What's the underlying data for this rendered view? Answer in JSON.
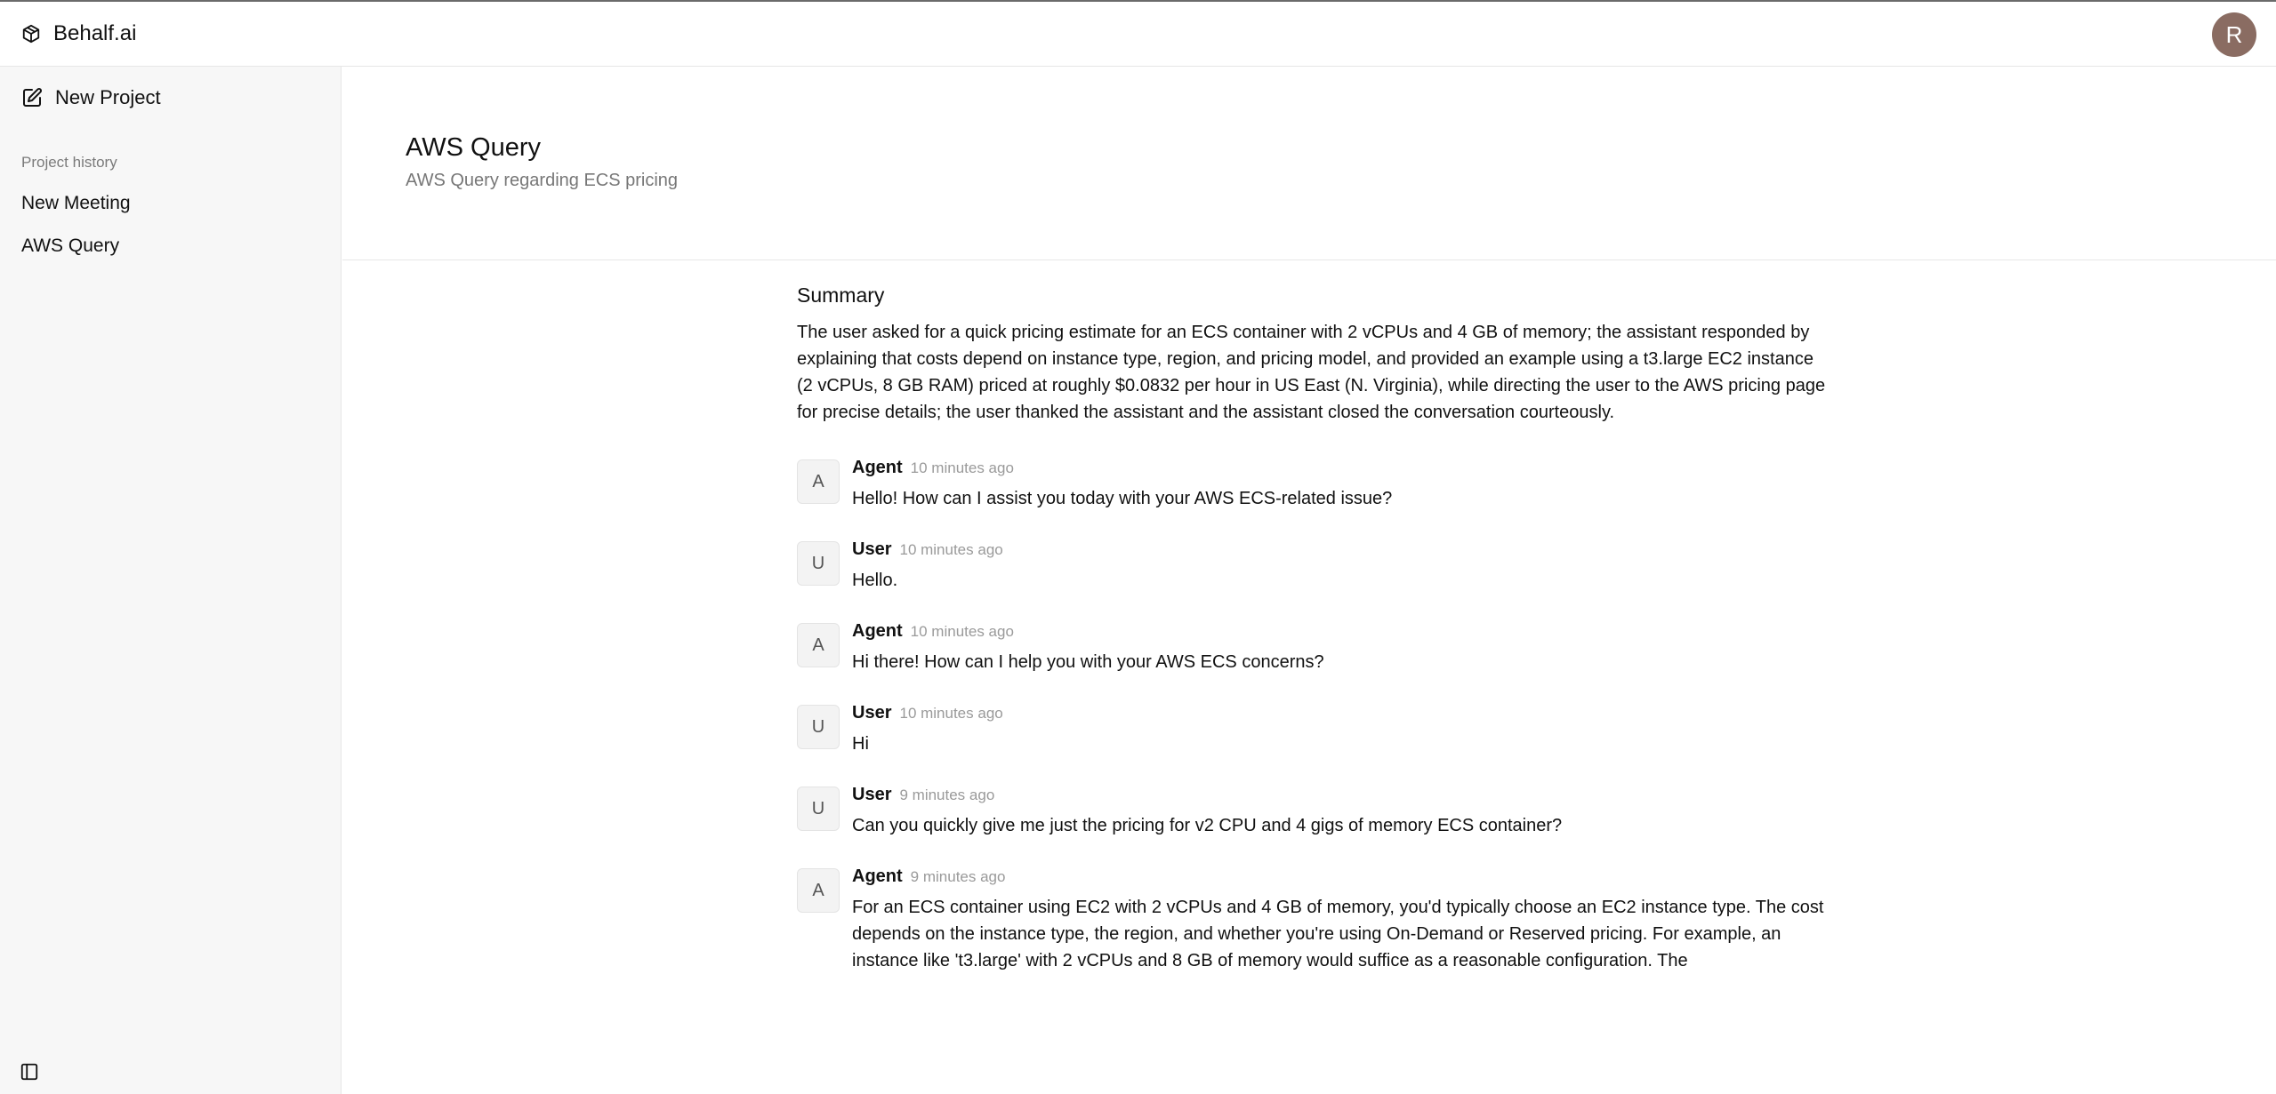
{
  "app": {
    "name": "Behalf.ai",
    "user_initial": "R"
  },
  "sidebar": {
    "new_project_label": "New Project",
    "history_label": "Project history",
    "items": [
      {
        "label": "New Meeting"
      },
      {
        "label": "AWS Query"
      }
    ]
  },
  "page": {
    "title": "AWS Query",
    "subtitle": "AWS Query regarding ECS pricing"
  },
  "summary": {
    "heading": "Summary",
    "text": "The user asked for a quick pricing estimate for an ECS container with 2 vCPUs and 4 GB of memory; the assistant responded by explaining that costs depend on instance type, region, and pricing model, and provided an example using a t3.large EC2 instance (2 vCPUs, 8 GB RAM) priced at roughly $0.0832 per hour in US East (N. Virginia), while directing the user to the AWS pricing page for precise details; the user thanked the assistant and the assistant closed the conversation courteously."
  },
  "messages": [
    {
      "initial": "A",
      "name": "Agent",
      "time": "10 minutes ago",
      "text": "Hello! How can I assist you today with your AWS ECS-related issue?"
    },
    {
      "initial": "U",
      "name": "User",
      "time": "10 minutes ago",
      "text": "Hello."
    },
    {
      "initial": "A",
      "name": "Agent",
      "time": "10 minutes ago",
      "text": "Hi there! How can I help you with your AWS ECS concerns?"
    },
    {
      "initial": "U",
      "name": "User",
      "time": "10 minutes ago",
      "text": "Hi"
    },
    {
      "initial": "U",
      "name": "User",
      "time": "9 minutes ago",
      "text": "Can you quickly give me just the pricing for v2 CPU and 4 gigs of memory ECS container?"
    },
    {
      "initial": "A",
      "name": "Agent",
      "time": "9 minutes ago",
      "text": "For an ECS container using EC2 with 2 vCPUs and 4 GB of memory, you'd typically choose an EC2 instance type. The cost depends on the instance type, the region, and whether you're using On-Demand or Reserved pricing. For example, an instance like 't3.large' with 2 vCPUs and 8 GB of memory would suffice as a reasonable configuration. The"
    }
  ]
}
